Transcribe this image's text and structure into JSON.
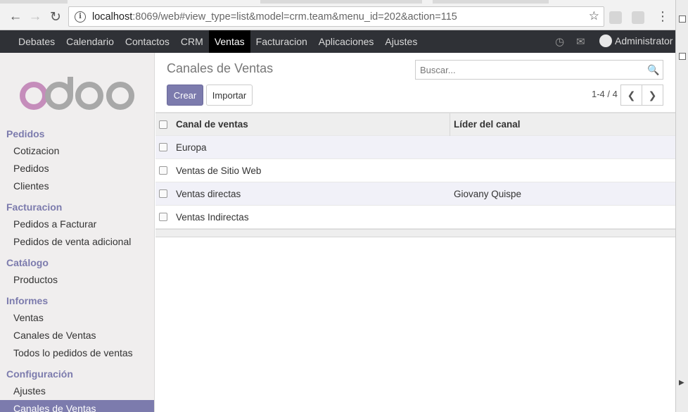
{
  "browser": {
    "url_host": "localhost",
    "url_rest": ":8069/web#view_type=list&model=crm.team&menu_id=202&action=115"
  },
  "topnav": {
    "items": [
      {
        "label": "Debates"
      },
      {
        "label": "Calendario"
      },
      {
        "label": "Contactos"
      },
      {
        "label": "CRM"
      },
      {
        "label": "Ventas",
        "active": true
      },
      {
        "label": "Facturacion"
      },
      {
        "label": "Aplicaciones"
      },
      {
        "label": "Ajustes"
      }
    ],
    "user": "Administrator",
    "icons": [
      "clock-icon",
      "chat-icon",
      "avatar"
    ]
  },
  "sidebar": {
    "sections": [
      {
        "title": "Pedidos",
        "items": [
          "Cotizacion",
          "Pedidos",
          "Clientes"
        ]
      },
      {
        "title": "Facturacion",
        "items": [
          "Pedidos a Facturar",
          "Pedidos de venta adicional"
        ]
      },
      {
        "title": "Catálogo",
        "items": [
          "Productos"
        ]
      },
      {
        "title": "Informes",
        "items": [
          "Ventas",
          "Canales de Ventas",
          "Todos lo pedidos de ventas"
        ]
      },
      {
        "title": "Configuración",
        "items": [
          "Ajustes",
          "Canales de Ventas"
        ]
      }
    ],
    "active_item": "Canales de Ventas"
  },
  "control_panel": {
    "title": "Canales de Ventas",
    "search_placeholder": "Buscar...",
    "create_label": "Crear",
    "import_label": "Importar",
    "pager": "1-4 / 4"
  },
  "list": {
    "columns": [
      "Canal de ventas",
      "Líder del canal"
    ],
    "rows": [
      {
        "name": "Europa",
        "leader": ""
      },
      {
        "name": "Ventas de Sitio Web",
        "leader": ""
      },
      {
        "name": "Ventas directas",
        "leader": "Giovany Quispe"
      },
      {
        "name": "Ventas Indirectas",
        "leader": ""
      }
    ]
  },
  "colors": {
    "accent": "#7c7bad",
    "topnav_bg": "#2f3136",
    "sidebar_bg": "#f0eeee"
  }
}
